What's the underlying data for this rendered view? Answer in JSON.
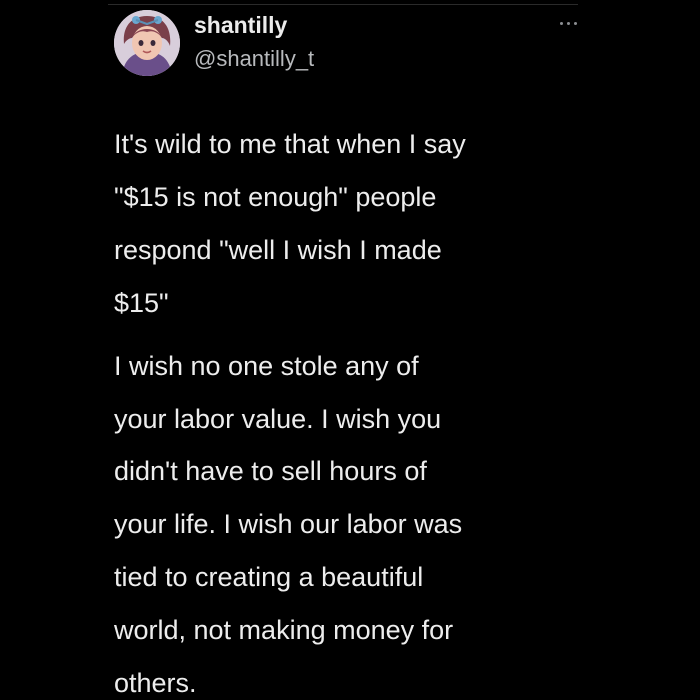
{
  "tweet": {
    "display_name": "shantilly",
    "handle": "@shantilly_t",
    "avatar_icon": "avatar-illustration-icon",
    "more_icon": "ellipsis-horizontal-icon",
    "paragraphs": [
      "It's wild to me that when I say\n\"$15 is not enough\" people\nrespond \"well I wish  I made\n$15\"",
      "I wish no one stole any of\nyour labor value. I wish you\ndidn't have to sell hours of\nyour life. I wish our labor was\ntied to creating a beautiful\nworld, not making money for\nothers."
    ]
  },
  "colors": {
    "background": "#000000",
    "text": "#ededed",
    "secondary_text": "#b8babd"
  }
}
